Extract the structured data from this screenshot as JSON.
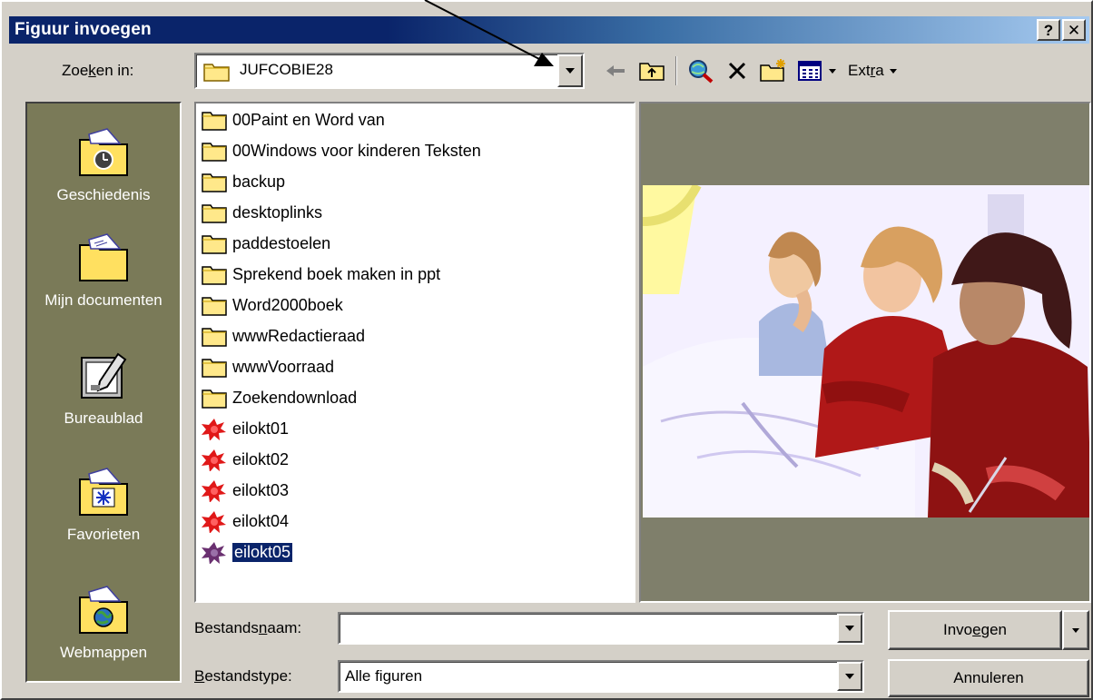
{
  "window": {
    "title": "Figuur invoegen",
    "help_button": "?",
    "close_button": "✕"
  },
  "lookin": {
    "label_pre": "Zoe",
    "label_u": "k",
    "label_post": "en in:",
    "value": "JUFCOBIE28"
  },
  "toolbar": {
    "back_icon": "back-arrow-icon",
    "up_icon": "up-folder-icon",
    "search_web_icon": "search-web-icon",
    "delete_icon": "delete-icon",
    "new_folder_icon": "new-folder-icon",
    "views_icon": "views-icon",
    "tools_label_pre": "Ext",
    "tools_label_u": "r",
    "tools_label_post": "a"
  },
  "places": [
    {
      "label": "Geschiedenis",
      "icon": "history-icon"
    },
    {
      "label": "Mijn documenten",
      "icon": "my-documents-icon"
    },
    {
      "label": "Bureaublad",
      "icon": "desktop-icon"
    },
    {
      "label": "Favorieten",
      "icon": "favorites-icon"
    },
    {
      "label": "Webmappen",
      "icon": "web-folders-icon"
    }
  ],
  "files": [
    {
      "name": "00Paint en Word van",
      "type": "folder"
    },
    {
      "name": "00Windows voor kinderen Teksten",
      "type": "folder"
    },
    {
      "name": "backup",
      "type": "folder"
    },
    {
      "name": "desktoplinks",
      "type": "folder"
    },
    {
      "name": "paddestoelen",
      "type": "folder"
    },
    {
      "name": "Sprekend boek maken in ppt",
      "type": "folder"
    },
    {
      "name": "Word2000boek",
      "type": "folder"
    },
    {
      "name": "wwwRedactieraad",
      "type": "folder"
    },
    {
      "name": "wwwVoorraad",
      "type": "folder"
    },
    {
      "name": "Zoekendownload",
      "type": "folder"
    },
    {
      "name": "eilokt01",
      "type": "image"
    },
    {
      "name": "eilokt02",
      "type": "image"
    },
    {
      "name": "eilokt03",
      "type": "image"
    },
    {
      "name": "eilokt04",
      "type": "image"
    },
    {
      "name": "eilokt05",
      "type": "image",
      "selected": true
    }
  ],
  "filename": {
    "label_pre": "Bestands",
    "label_u": "n",
    "label_post": "aam:",
    "value": ""
  },
  "filetype": {
    "label_u": "B",
    "label_post": "estandstype:",
    "value": "Alle figuren"
  },
  "buttons": {
    "insert_pre": "Invo",
    "insert_u": "e",
    "insert_post": "gen",
    "cancel": "Annuleren"
  },
  "colors": {
    "title_bar": "#0a246a",
    "face": "#d4d0c8",
    "places_bg": "#7a7a58",
    "selection": "#0a246a"
  }
}
